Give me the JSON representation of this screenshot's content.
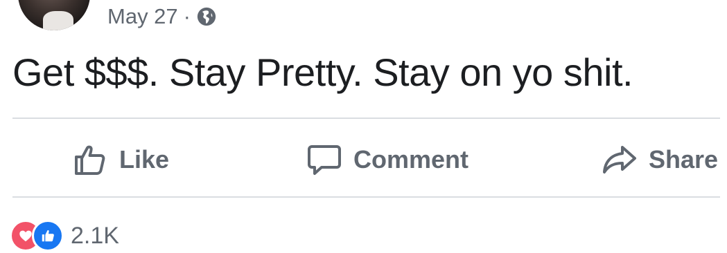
{
  "post": {
    "date": "May 27",
    "separator": "·",
    "privacy_icon": "globe-icon",
    "text": "Get $$$. Stay Pretty. Stay on yo shit."
  },
  "actions": {
    "like_label": "Like",
    "comment_label": "Comment",
    "share_label": "Share"
  },
  "reactions": {
    "types": [
      "love",
      "like"
    ],
    "count": "2.1K"
  },
  "colors": {
    "text_primary": "#1c1e21",
    "text_secondary": "#606770",
    "divider": "#dadde1",
    "love": "#f25268",
    "like": "#1877f2"
  }
}
